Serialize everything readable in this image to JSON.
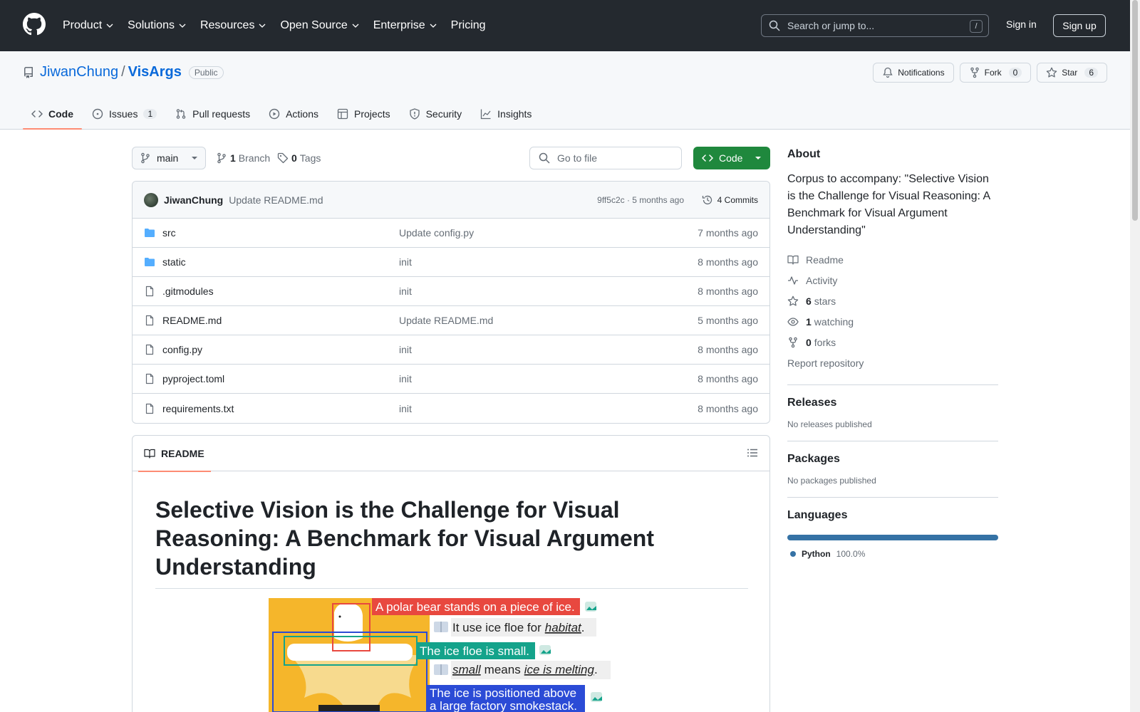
{
  "header": {
    "nav": [
      "Product",
      "Solutions",
      "Resources",
      "Open Source",
      "Enterprise",
      "Pricing"
    ],
    "search_placeholder": "Search or jump to...",
    "search_shortcut": "/",
    "signin": "Sign in",
    "signup": "Sign up"
  },
  "repo": {
    "owner": "JiwanChung",
    "separator": "/",
    "name": "VisArgs",
    "visibility": "Public",
    "notifications": "Notifications",
    "fork_label": "Fork",
    "fork_count": "0",
    "star_label": "Star",
    "star_count": "6",
    "tabs": [
      {
        "label": "Code",
        "icon": "code-icon"
      },
      {
        "label": "Issues",
        "icon": "issue-icon",
        "count": "1"
      },
      {
        "label": "Pull requests",
        "icon": "pull-request-icon"
      },
      {
        "label": "Actions",
        "icon": "play-icon"
      },
      {
        "label": "Projects",
        "icon": "table-icon"
      },
      {
        "label": "Security",
        "icon": "shield-icon"
      },
      {
        "label": "Insights",
        "icon": "graph-icon"
      }
    ]
  },
  "toolbar": {
    "branch": "main",
    "branch_count": "1",
    "branch_label": "Branch",
    "tag_count": "0",
    "tag_label": "Tags",
    "goto_placeholder": "Go to file",
    "code_button": "Code"
  },
  "commit": {
    "author": "JiwanChung",
    "message": "Update README.md",
    "meta": "9ff5c2c · 5 months ago",
    "commits": "4 Commits"
  },
  "files": [
    {
      "name": "src",
      "type": "folder",
      "message": "Update config.py",
      "date": "7 months ago"
    },
    {
      "name": "static",
      "type": "folder",
      "message": "init",
      "date": "8 months ago"
    },
    {
      "name": ".gitmodules",
      "type": "file",
      "message": "init",
      "date": "8 months ago"
    },
    {
      "name": "README.md",
      "type": "file",
      "message": "Update README.md",
      "date": "5 months ago"
    },
    {
      "name": "config.py",
      "type": "file",
      "message": "init",
      "date": "8 months ago"
    },
    {
      "name": "pyproject.toml",
      "type": "file",
      "message": "init",
      "date": "8 months ago"
    },
    {
      "name": "requirements.txt",
      "type": "file",
      "message": "init",
      "date": "8 months ago"
    }
  ],
  "readme": {
    "tab": "README",
    "title": "Selective Vision is the Challenge for Visual Reasoning: A Benchmark for Visual Argument Understanding",
    "figure": {
      "captions": [
        "A polar bear stands on a piece of ice.",
        "It use ice floe for",
        "habitat",
        "The ice floe is small.",
        "small",
        "means",
        "ice is melting",
        "The ice is positioned above",
        "a large factory smokestack."
      ]
    }
  },
  "sidebar": {
    "about_title": "About",
    "description": "Corpus to accompany: \"Selective Vision is the Challenge for Visual Reasoning: A Benchmark for Visual Argument Understanding\"",
    "readme": "Readme",
    "activity": "Activity",
    "stars_count": "6",
    "stars_label": "stars",
    "watching_count": "1",
    "watching_label": "watching",
    "forks_count": "0",
    "forks_label": "forks",
    "report": "Report repository",
    "releases_title": "Releases",
    "releases_text": "No releases published",
    "packages_title": "Packages",
    "packages_text": "No packages published",
    "languages_title": "Languages",
    "languages": [
      {
        "name": "Python",
        "percent": "100.0%",
        "color": "#3572a5"
      }
    ]
  },
  "colors": {
    "header_bg": "#24292f",
    "link": "#0969da",
    "green": "#1f883d",
    "tab_underline": "#fd8c73"
  }
}
